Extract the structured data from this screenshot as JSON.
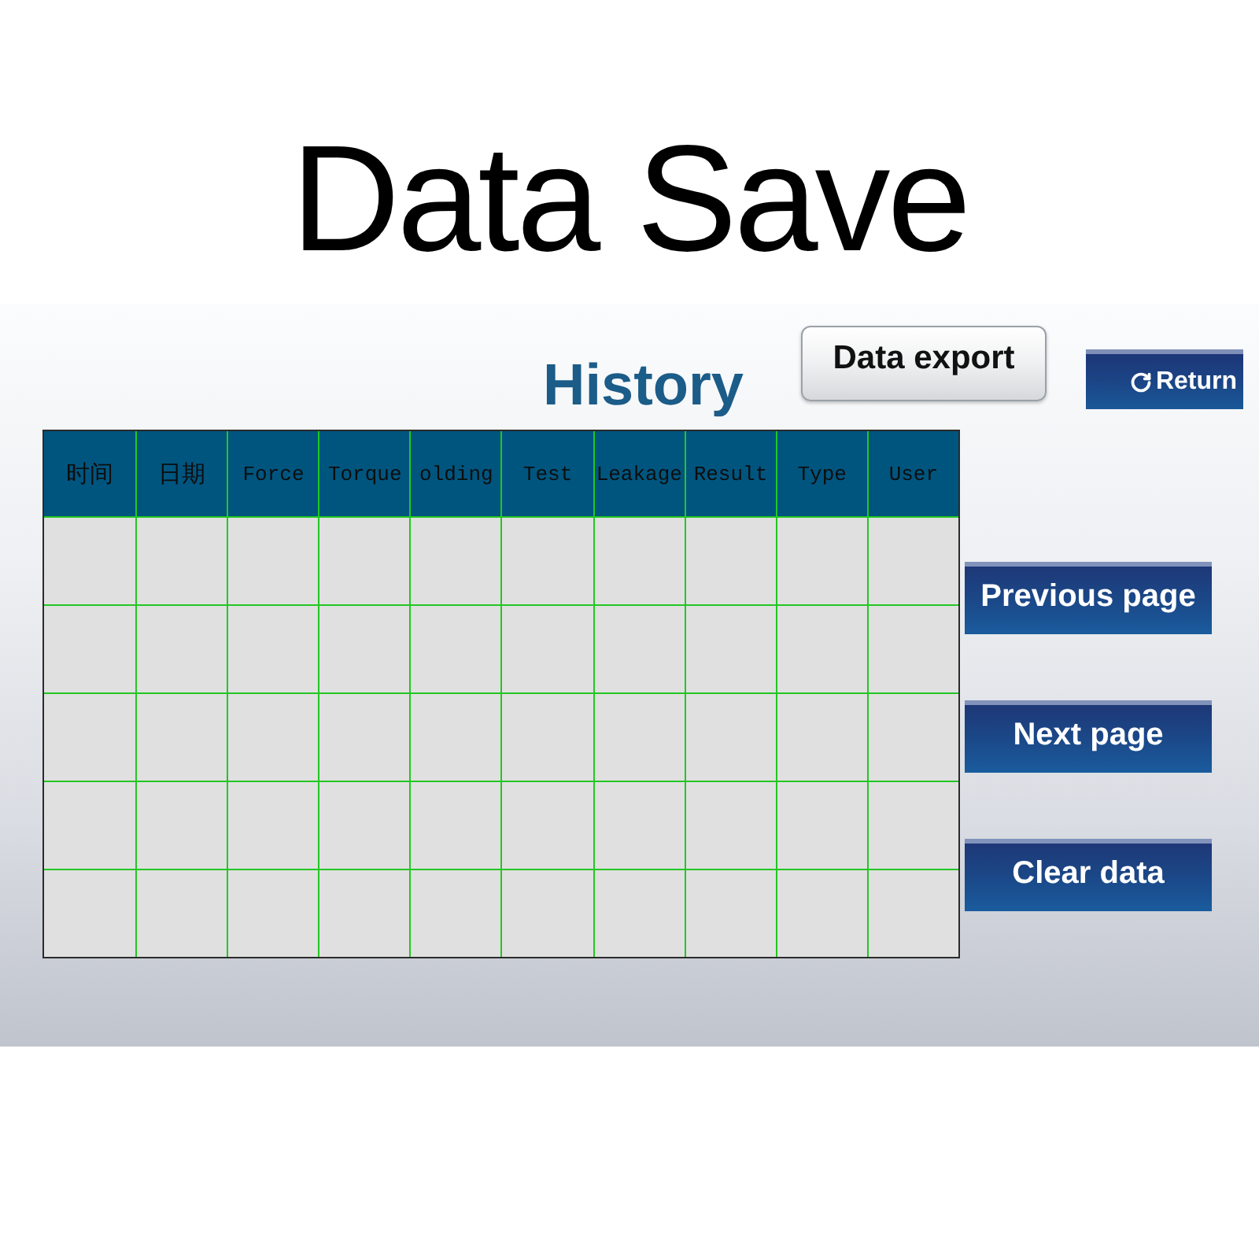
{
  "title": "Data Save",
  "panel": {
    "heading": "History",
    "toolbar": [
      {
        "kind": "export",
        "label": "Data export"
      },
      {
        "kind": "return",
        "label": "Return"
      }
    ],
    "table": {
      "columns": [
        "时间",
        "日期",
        "Force",
        "Torque",
        "olding",
        "Test",
        "Leakage",
        "Result",
        "Type",
        "User"
      ],
      "rows": [
        {
          "selected": false
        },
        {
          "selected": false
        },
        {
          "selected": false
        },
        {
          "selected": false
        },
        {
          "selected": false
        }
      ]
    },
    "side_buttons": [
      "Previous page",
      "Next page",
      "Clear data"
    ]
  }
}
